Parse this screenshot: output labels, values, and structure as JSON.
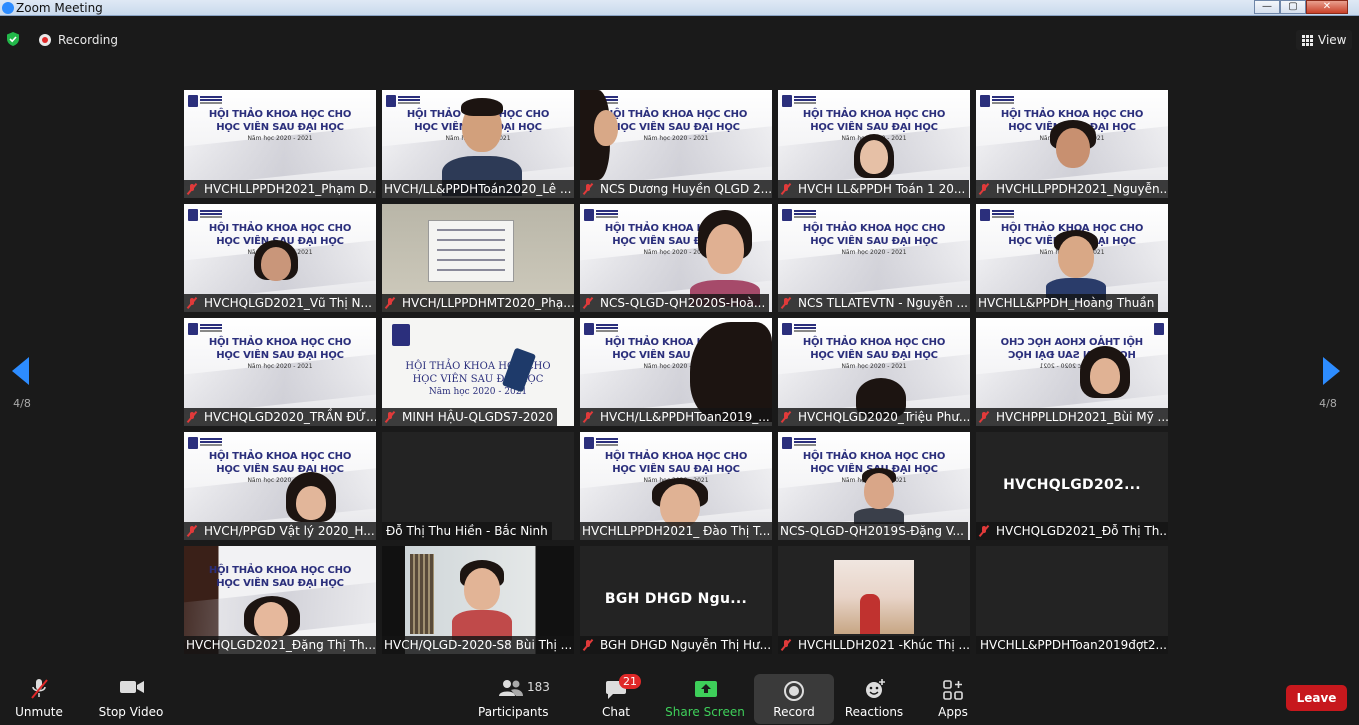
{
  "window": {
    "title": "Zoom Meeting",
    "minimize": "—",
    "maximize": "▢",
    "close": "✕"
  },
  "topbar": {
    "recording_label": "Recording",
    "view_label": "View"
  },
  "pagination": {
    "left": "4/8",
    "right": "4/8"
  },
  "slide": {
    "line1": "HỘI THẢO KHOA HỌC CHO",
    "line2": "HỌC VIÊN SAU ĐẠI HỌC",
    "line3": "Năm học 2020 - 2021"
  },
  "tiles": [
    {
      "name": "HVCHLLPPDH2021_Phạm D...",
      "muted": true
    },
    {
      "name": "HVCH/LL&PPDHToán2020_Lê ...",
      "muted": false
    },
    {
      "name": "NCS Dương Huyền QLGD 2...",
      "muted": true
    },
    {
      "name": "HVCH LL&PPDH Toán 1 20...",
      "muted": true
    },
    {
      "name": "HVCHLLPPDH2021_Nguyễn...",
      "muted": true
    },
    {
      "name": "HVCHQLGD2021_Vũ Thị N...",
      "muted": true
    },
    {
      "name": "HVCH/LLPPDHMT2020_Phạ...",
      "muted": true
    },
    {
      "name": "NCS-QLGD-QH2020S-Hoà...",
      "muted": true
    },
    {
      "name": "NCS TLLATEVTN - Nguyễn ...",
      "muted": true
    },
    {
      "name": "HVCHLL&PPDH_Hoàng Thuần",
      "muted": false
    },
    {
      "name": "HVCHQLGD2020_TRẦN ĐỨ...",
      "muted": true
    },
    {
      "name": "MINH HẬU-QLGDS7-2020",
      "muted": true
    },
    {
      "name": "HVCH/LL&PPDHToan2019_...",
      "muted": true
    },
    {
      "name": "HVCHQLGD2020_Triệu Phư...",
      "muted": true
    },
    {
      "name": "HVCHPPLLDH2021_Bùi Mỹ ...",
      "muted": true
    },
    {
      "name": "HVCH/PPGD Vật lý 2020_H...",
      "muted": true
    },
    {
      "name": "Đỗ Thị Thu Hiền - Bắc Ninh",
      "muted": false,
      "center_name": ""
    },
    {
      "name": "HVCHLLPPDH2021_ Đào Thị T...",
      "muted": false
    },
    {
      "name": "NCS-QLGD-QH2019S-Đặng V...",
      "muted": false
    },
    {
      "name": "HVCHQLGD2021_Đỗ Thị Th...",
      "muted": true,
      "center_name": "HVCHQLGD202..."
    },
    {
      "name": "HVCHQLGD2021_Đặng Thị Th...",
      "muted": false
    },
    {
      "name": "HVCH/QLGD-2020-S8 Bùi Thị ...",
      "muted": false
    },
    {
      "name": "BGH DHGD Nguyễn Thị Hư...",
      "muted": true,
      "center_name": "BGH DHGD Ngu..."
    },
    {
      "name": "HVCHLLDH2021 -Khúc Thị ...",
      "muted": true
    },
    {
      "name": "HVCHLL&PPDHToan2019đợt2...",
      "muted": false
    }
  ],
  "toolbar": {
    "unmute": "Unmute",
    "stop_video": "Stop Video",
    "participants": "Participants",
    "participants_count": "183",
    "chat": "Chat",
    "chat_badge": "21",
    "share_screen": "Share Screen",
    "record": "Record",
    "reactions": "Reactions",
    "apps": "Apps",
    "leave": "Leave"
  },
  "colors": {
    "accent": "#2d8cff",
    "leave": "#c7181d",
    "share": "#3ecf5a",
    "muted": "#e03a3a"
  }
}
